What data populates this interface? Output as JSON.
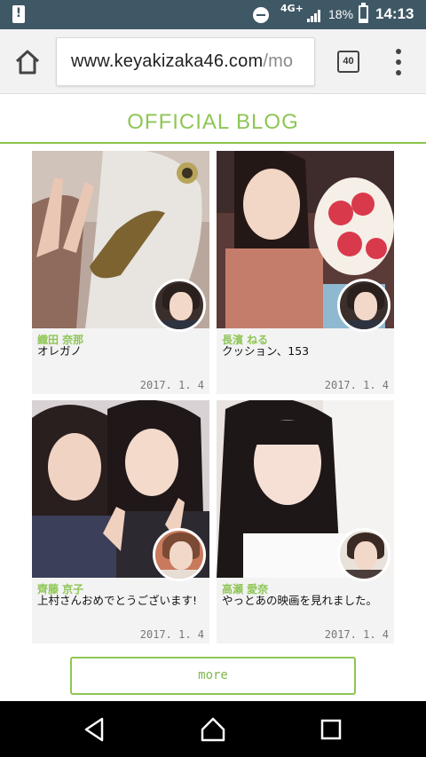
{
  "status_bar": {
    "network": "4G+",
    "battery": "18%",
    "time": "14:13"
  },
  "browser": {
    "url_main": "www.keyakizaka46.com",
    "url_rest": "/mo",
    "tab_count": "40"
  },
  "page": {
    "heading": "OFFICIAL BLOG",
    "more_label": "more"
  },
  "posts": [
    {
      "author": "織田 奈那",
      "title": "オレガノ",
      "date": "2017. 1. 4"
    },
    {
      "author": "長濱 ねる",
      "title": "クッション、153",
      "date": "2017. 1. 4"
    },
    {
      "author": "齊藤 京子",
      "title": "上村さんおめでとうございます!",
      "date": "2017. 1. 4"
    },
    {
      "author": "高瀬 愛奈",
      "title": "やっとあの映画を見れました。",
      "date": "2017. 1. 4"
    }
  ],
  "colors": {
    "accent": "#8ec655",
    "status_bar": "#3f5866",
    "card_bg": "#f3f3f3"
  },
  "icons": [
    "alert-icon",
    "dnd-icon",
    "signal-icon",
    "battery-icon",
    "home-icon",
    "tab-switcher-icon",
    "more-vert-icon",
    "back-icon",
    "home-nav-icon",
    "recents-icon"
  ]
}
